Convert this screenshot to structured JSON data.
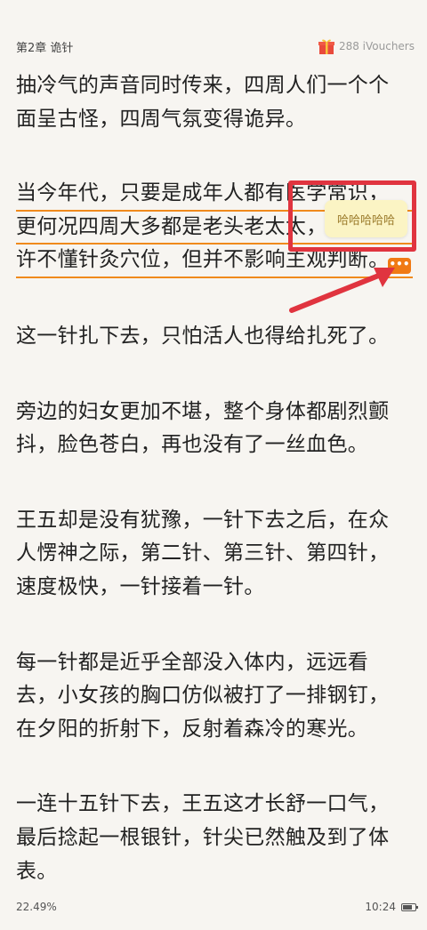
{
  "header": {
    "chapter_title": "第2章 诡针",
    "vouchers": "288 iVouchers"
  },
  "paragraphs": [
    {
      "lines": [
        "抽冷气的声音同时传来，四周人们一个个",
        "面呈古怪，四周气氛变得诡异。"
      ]
    },
    {
      "underlined": true,
      "lines": [
        "当今年代，只要是成年人都有医学常识，",
        "更何况四周大多都是老头老太太，他们或",
        "许不懂针灸穴位，但并不影响主观判断。"
      ]
    },
    {
      "lines": [
        "这一针扎下去，只怕活人也得给扎死了。"
      ]
    },
    {
      "lines": [
        "旁边的妇女更加不堪，整个身体都剧烈颤",
        "抖，脸色苍白，再也没有了一丝血色。"
      ]
    },
    {
      "lines": [
        "王五却是没有犹豫，一针下去之后，在众",
        "人愣神之际，第二针、第三针、第四针，",
        "速度极快，一针接着一针。"
      ]
    },
    {
      "lines": [
        "每一针都是近乎全部没入体内，远远看",
        "去，小女孩的胸口仿似被打了一排钢钉，",
        "在夕阳的折射下，反射着森冷的寒光。"
      ]
    },
    {
      "lines": [
        "一连十五针下去，王五这才长舒一口气，",
        "最后捻起一根银针，针尖已然触及到了体",
        "表。"
      ]
    }
  ],
  "comment_bubble": {
    "text": "哈哈哈哈哈"
  },
  "more_button": {
    "label": "•••"
  },
  "footer": {
    "progress": "22.49%",
    "time": "10:24",
    "battery_level": 0.8
  },
  "colors": {
    "background": "#f7f5f1",
    "underline": "#f08a1c",
    "annotation_red": "#e0343f",
    "more_button": "#f07a14",
    "bubble": "#fbf4c4"
  }
}
